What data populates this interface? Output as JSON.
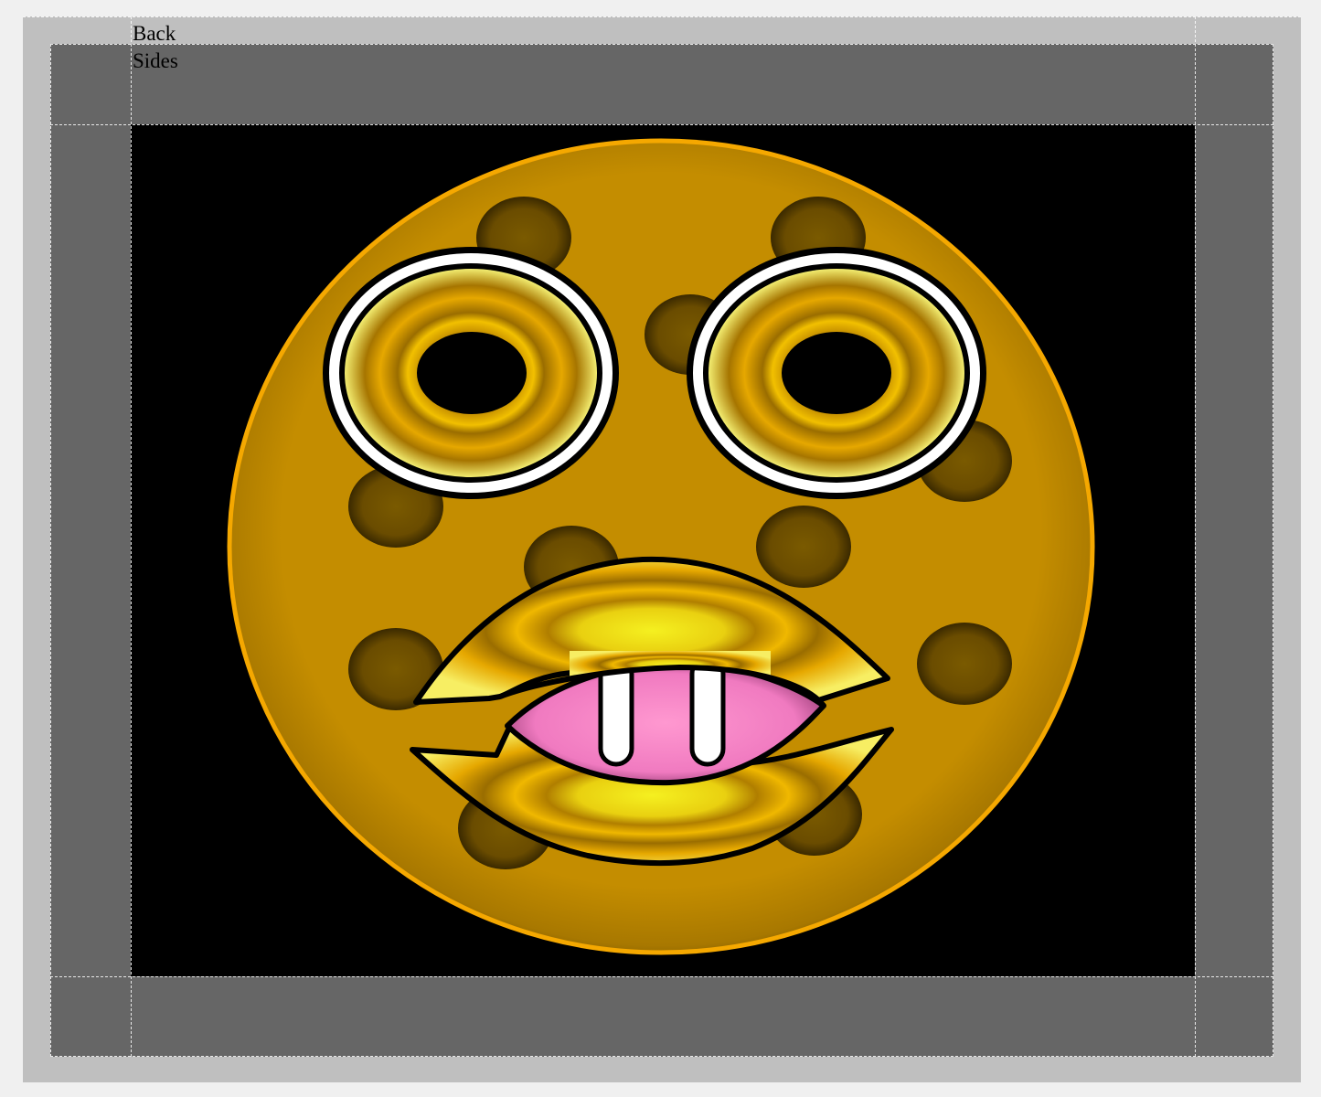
{
  "labels": {
    "back": "Back",
    "sides": "Sides"
  },
  "colors": {
    "page_background": "#f0f0f0",
    "print_area": "#bfbfbf",
    "bleed_area": "#666666",
    "artwork_background": "#000000",
    "face_fill": "#c48d00",
    "face_rim": "#f5a800",
    "spot": "#6e5000",
    "eye_ring": "#ffffff",
    "lip_yellow": "#f7ee63",
    "tongue_pink": "#f58ac8",
    "teeth": "#ffffff",
    "outline": "#000000"
  },
  "artwork": {
    "subject": "cartoon-face",
    "icons": [
      "face-icon",
      "spot-icon",
      "eye-icon",
      "mouth-icon",
      "tooth-icon"
    ]
  }
}
